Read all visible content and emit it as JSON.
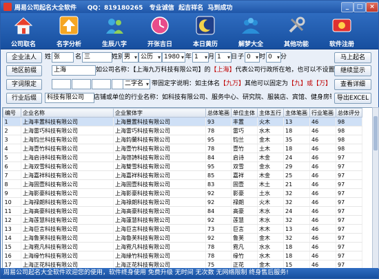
{
  "window": {
    "title": "周易公司起名大全软件",
    "qq": "QQ：819180265",
    "slogans": [
      "专业诚信",
      "起吉祥名",
      "马到成功"
    ]
  },
  "toolbar": [
    {
      "label": "公司取名",
      "icon": "home-icon",
      "color": "#e8402c"
    },
    {
      "label": "名字分析",
      "icon": "up-arrow-icon",
      "color": "#f5a623"
    },
    {
      "label": "生辰八字",
      "icon": "people-icon",
      "color": "#3fa9e0"
    },
    {
      "label": "开张吉日",
      "icon": "clock-icon",
      "color": "#e84c8b"
    },
    {
      "label": "本日黄历",
      "icon": "moon-icon",
      "color": "#1f3f8a"
    },
    {
      "label": "解梦大全",
      "icon": "group-icon",
      "color": "#2a8fd8"
    },
    {
      "label": "其他功能",
      "icon": "tools-icon",
      "color": "#d0d0d0"
    },
    {
      "label": "软件注册",
      "icon": "register-icon",
      "color": "#e03030"
    }
  ],
  "form": {
    "legal_btn": "企业法人",
    "surname_label": "姓",
    "surname": "张",
    "name_label": "名",
    "given_name": "三",
    "gender_label": "姓别",
    "gender": "男",
    "calendar": "公历",
    "year": "1980",
    "year_unit": "年",
    "month": "1",
    "month_unit": "月",
    "day": "1",
    "day_unit": "日",
    "hour_label": "子",
    "hour": "0",
    "hour_unit": "时",
    "minute": "0",
    "minute_unit": "分",
    "start_btn": "马上起名",
    "region_btn": "地区前缀",
    "region": "上海",
    "region_hint_pre": "如公司名称：【上海九万科技有限公司】的",
    "region_hint_mark": "【上海】",
    "region_hint_post": "代表公司行政所在地，也可以不设置",
    "continue_btn": "继续显示",
    "char_btn": "字词限定",
    "char_select": "二字名",
    "char_hint_pre": "带固定字说明：如主体名",
    "char_hint_mark1": "【九万】",
    "char_hint_mid": "其他可以固定为",
    "char_hint_mark2": "【九】或【万】",
    "detail_btn": "查看详细",
    "industry_btn": "行业后缀",
    "industry": "科技有限公司",
    "industry_hint": "店铺或单位的行业名称：如科技有限公司、服务中心、研究院、服装店、宾馆、健身房等",
    "export_btn": "导出EXCEL"
  },
  "table": {
    "columns": [
      "编号",
      "企业名称",
      "企业繁体字",
      "总体笔画",
      "单位主体",
      "主体五行",
      "主体笔画",
      "行业笔画",
      "总体评分"
    ],
    "rows": [
      [
        "1",
        "上海丰置科技有限公司",
        "上海豐置科技有限公司",
        "93",
        "丰置",
        "火木",
        "13",
        "46",
        "98"
      ],
      [
        "2",
        "上海雷巧科技有限公司",
        "上海雷巧科技有限公司",
        "78",
        "雷巧",
        "水木",
        "18",
        "46",
        "98"
      ],
      [
        "3",
        "上海钧兰科技有限公司",
        "上海鈞蘭科技有限公司",
        "95",
        "钧兰",
        "金木",
        "35",
        "46",
        "98"
      ],
      [
        "4",
        "上海壹竹科技有限公司",
        "上海壹竹科技有限公司",
        "78",
        "壹竹",
        "土木",
        "18",
        "46",
        "98"
      ],
      [
        "5",
        "上海启诗科技有限公司",
        "上海啓詩科技有限公司",
        "84",
        "启诗",
        "木金",
        "24",
        "46",
        "97"
      ],
      [
        "6",
        "上海双雪科技有限公司",
        "上海雙雪科技有限公司",
        "95",
        "双雪",
        "金水",
        "29",
        "46",
        "97"
      ],
      [
        "7",
        "上海嘉祥科技有限公司",
        "上海嘉祥科技有限公司",
        "85",
        "嘉祥",
        "木金",
        "25",
        "46",
        "97"
      ],
      [
        "8",
        "上海固壹科技有限公司",
        "上海固壹科技有限公司",
        "83",
        "固壹",
        "木土",
        "21",
        "46",
        "97"
      ],
      [
        "9",
        "上海影豪科技有限公司",
        "上海影豪科技有限公司",
        "92",
        "影豪",
        "土水",
        "32",
        "46",
        "97"
      ],
      [
        "10",
        "上海禄朗科技有限公司",
        "上海祿朗科技有限公司",
        "92",
        "禄朗",
        "火木",
        "32",
        "46",
        "97"
      ],
      [
        "11",
        "上海高豪科技有限公司",
        "上海高豪科技有限公司",
        "84",
        "高豪",
        "木水",
        "24",
        "46",
        "97"
      ],
      [
        "12",
        "上海莲慧科技有限公司",
        "上海蓮慧科技有限公司",
        "92",
        "莲慧",
        "木水",
        "32",
        "46",
        "97"
      ],
      [
        "13",
        "上海巨言科技有限公司",
        "上海巨言科技有限公司",
        "73",
        "巨言",
        "木木",
        "13",
        "46",
        "97"
      ],
      [
        "14",
        "上海鲁芙科技有限公司",
        "上海魯芙科技有限公司",
        "92",
        "鲁芙",
        "金木",
        "32",
        "46",
        "97"
      ],
      [
        "15",
        "上海霓凡科技有限公司",
        "上海霓凡科技有限公司",
        "78",
        "霓凡",
        "水水",
        "18",
        "46",
        "97"
      ],
      [
        "16",
        "上海缘竹科技有限公司",
        "上海緣竹科技有限公司",
        "78",
        "缘竹",
        "水木",
        "18",
        "46",
        "97"
      ],
      [
        "17",
        "上海正花科技有限公司",
        "上海正花科技有限公司",
        "75",
        "正花",
        "金木",
        "15",
        "46",
        "97"
      ]
    ]
  },
  "status": "周易公司起名大全软件欢迎您的使用，软件终身使用  免费升级  无时间  无次数  无网络限制  终身售后服务!"
}
